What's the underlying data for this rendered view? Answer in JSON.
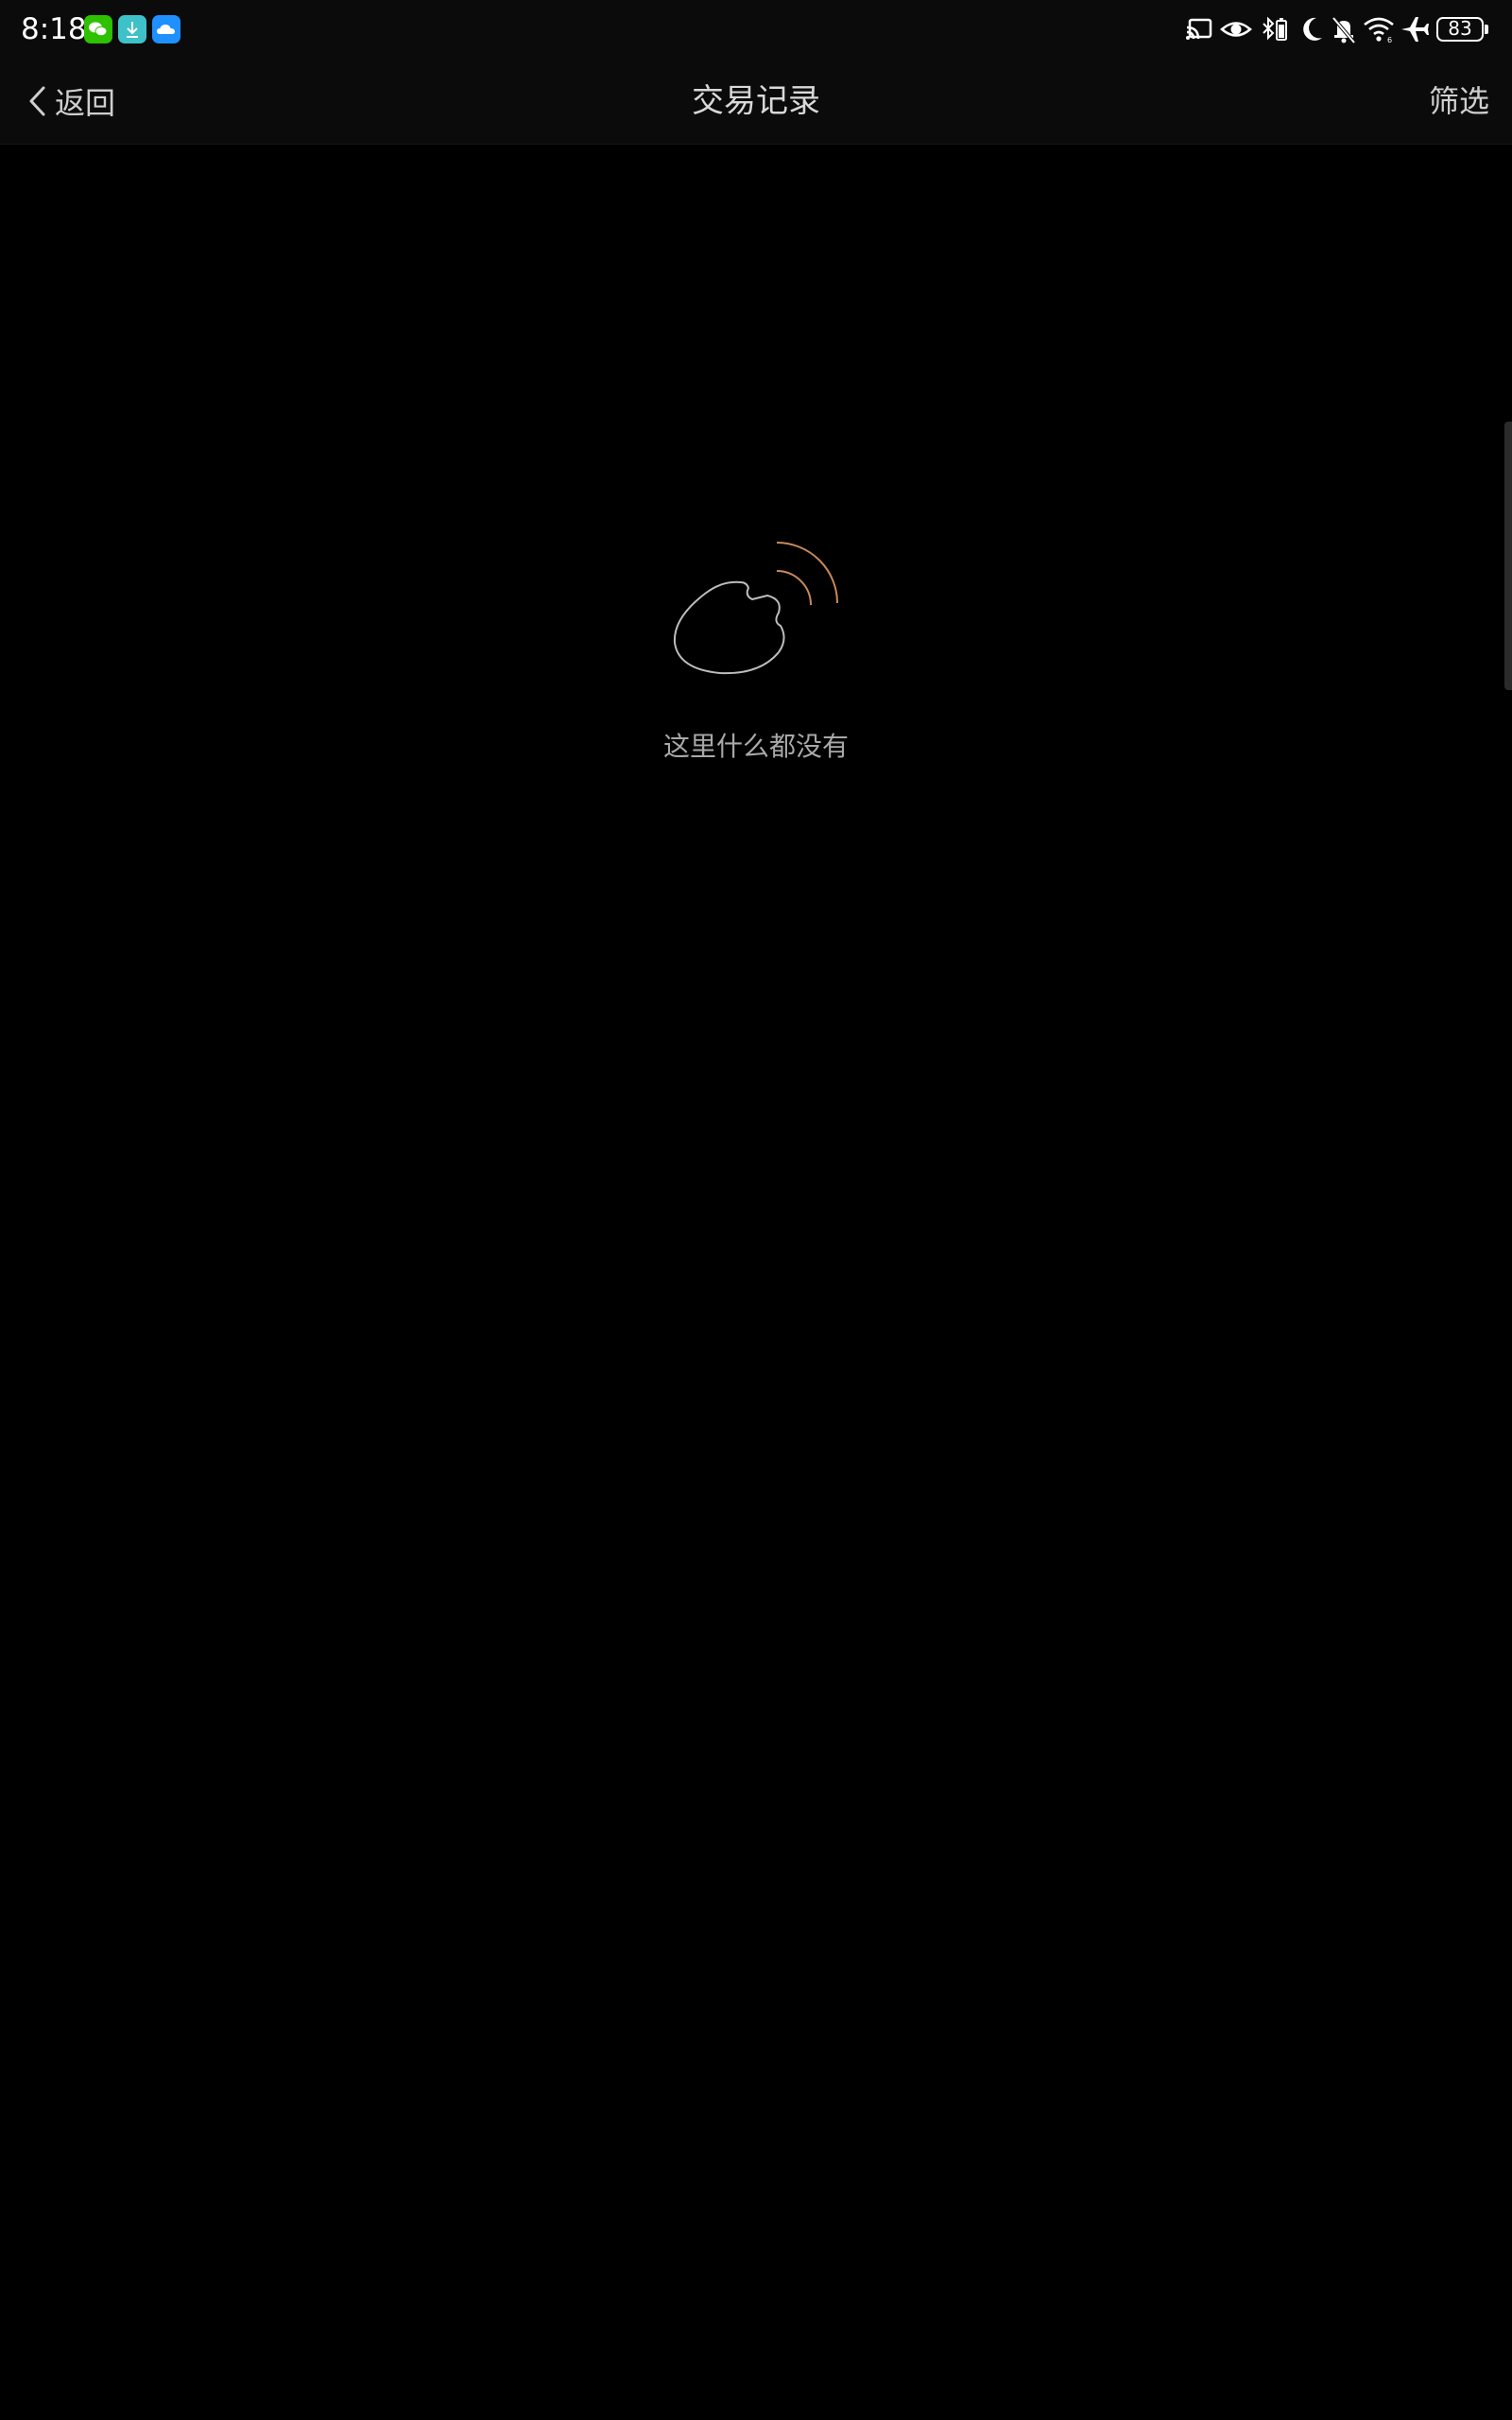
{
  "status_bar": {
    "time": "8:18",
    "battery_level": "83",
    "notification_icons": [
      "wechat-icon",
      "download-icon",
      "cloud-icon"
    ],
    "system_icons": [
      "screen-cast-icon",
      "eye-icon",
      "bluetooth-battery-icon",
      "moon-icon",
      "bell-off-icon",
      "wifi-icon",
      "airplane-icon",
      "battery-icon"
    ]
  },
  "nav": {
    "back_label": "返回",
    "title": "交易记录",
    "filter_label": "筛选"
  },
  "empty_state": {
    "message": "这里什么都没有"
  },
  "colors": {
    "background": "#000000",
    "bar_background": "#0b0b0b",
    "illustration_stroke": "#bdbdbd",
    "illustration_accent": "#c8895a",
    "wechat_green": "#2dc100",
    "download_teal": "#3fc1c9",
    "cloud_blue": "#1e90ff"
  }
}
